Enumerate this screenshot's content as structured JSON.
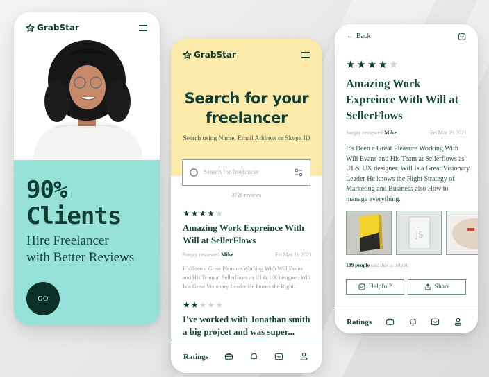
{
  "brand": {
    "name": "GrabStar",
    "primary": "#0f3d33",
    "teal": "#96e2d9",
    "yellow": "#fbeaa9"
  },
  "landing": {
    "headline_line1": "90%",
    "headline_line2": "Clients",
    "sub_line1": "Hire Freelancer",
    "sub_line2": "with Better Reviews",
    "go_label": "GO"
  },
  "search_screen": {
    "title_line1": "Search for your",
    "title_line2": "freelancer",
    "hint": "Search using Name, Email Address or Skype ID",
    "search_placeholder": "Search for freelancer",
    "reviews_count": "3728 reviews",
    "reviews": [
      {
        "stars": 4,
        "title": "Amazing Work Expreince With Will at SellerFlows",
        "reviewer": "Sanjay reviewed",
        "reviewee": "Mike",
        "date": "Fri Mar 19 2021",
        "excerpt": "It's Been a Great Pleasure Working With Will Evans and His Team at Sellerflows as UI & UX designer. Will Is a Great Visionary Leader He knows the Right..."
      },
      {
        "stars": 2,
        "title": "I've worked with Jonathan smith a big projcet and was super..."
      }
    ]
  },
  "detail_screen": {
    "back_label": "Back",
    "stars": 4,
    "title": "Amazing Work Expreince With Will at SellerFlows",
    "reviewer": "Sanjay reviewed",
    "reviewee": "Mike",
    "date": "Fri Mar 19 2021",
    "body": "It's Been a Great Pleasure Working With Will Evans and His Team at Sellerflows as UI & UX designer. Will Is a Great Visionary Leader He knows the Right Strategy of Marketing and Business also How to manage everything.",
    "helpful_count": "189 people",
    "helpful_suffix": "said this is helpful",
    "helpful_button": "Helpful?",
    "share_button": "Share"
  },
  "bottom_nav": {
    "ratings_label": "Ratings",
    "icons": [
      "briefcase-icon",
      "bell-icon",
      "mail-icon",
      "user-icon"
    ]
  }
}
